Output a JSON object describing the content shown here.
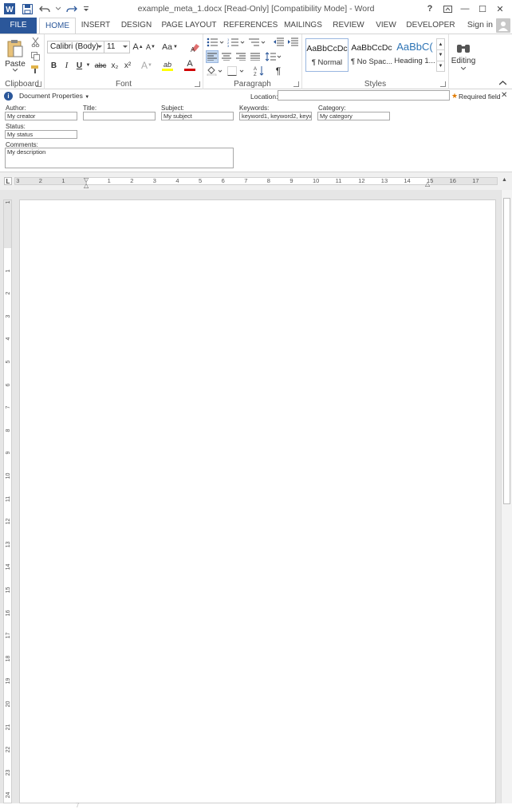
{
  "window": {
    "title": "example_meta_1.docx [Read-Only] [Compatibility Mode] - Word",
    "help": "?",
    "restore": "▭",
    "minimize": "—",
    "maximize": "☐",
    "close": "✕"
  },
  "tabs": [
    {
      "label": "FILE"
    },
    {
      "label": "HOME"
    },
    {
      "label": "INSERT"
    },
    {
      "label": "DESIGN"
    },
    {
      "label": "PAGE LAYOUT"
    },
    {
      "label": "REFERENCES"
    },
    {
      "label": "MAILINGS"
    },
    {
      "label": "REVIEW"
    },
    {
      "label": "VIEW"
    },
    {
      "label": "DEVELOPER"
    }
  ],
  "signin": "Sign in",
  "ribbon": {
    "clipboard": {
      "label": "Clipboard",
      "paste": "Paste"
    },
    "font": {
      "label": "Font",
      "font_name": "Calibri (Body)",
      "font_size": "11",
      "grow": "A",
      "shrink": "A",
      "case": "Aa",
      "bold": "B",
      "italic": "I",
      "underline": "U",
      "strike": "abc",
      "subscript": "x₂",
      "superscript": "x²",
      "effects": "A",
      "highlight": "ab",
      "color": "A"
    },
    "paragraph": {
      "label": "Paragraph",
      "pilcrow": "¶"
    },
    "styles": {
      "label": "Styles",
      "items": [
        {
          "sample": "AaBbCcDc",
          "name": "¶ Normal"
        },
        {
          "sample": "AaBbCcDc",
          "name": "¶ No Spac..."
        },
        {
          "sample": "AaBbC(",
          "name": "Heading 1..."
        }
      ]
    },
    "editing": {
      "label": "Editing"
    }
  },
  "docprops": {
    "header": "Document Properties",
    "location_label": "Location:",
    "location_value": "",
    "required": "Required field",
    "fields": {
      "author": {
        "label": "Author:",
        "value": "My creator"
      },
      "title": {
        "label": "Title:",
        "value": ""
      },
      "subject": {
        "label": "Subject:",
        "value": "My subject"
      },
      "keywords": {
        "label": "Keywords:",
        "value": "keyword1, keyword2, keywor"
      },
      "category": {
        "label": "Category:",
        "value": "My category"
      },
      "status": {
        "label": "Status:",
        "value": "My status"
      },
      "comments": {
        "label": "Comments:",
        "value": "My description"
      }
    }
  },
  "ruler": {
    "h_labels": [
      "3",
      "2",
      "1",
      "1",
      "2",
      "3",
      "4",
      "5",
      "6",
      "7",
      "8",
      "9",
      "10",
      "11",
      "12",
      "13",
      "14",
      "15",
      "16",
      "17"
    ],
    "v_labels": [
      "1",
      "1",
      "2",
      "3",
      "4",
      "5",
      "6",
      "7",
      "8",
      "9",
      "10",
      "11",
      "12",
      "13",
      "14",
      "15",
      "16",
      "17",
      "18",
      "19",
      "20",
      "21",
      "22",
      "23",
      "24"
    ],
    "tab_marker": "L"
  },
  "page_hint": "7",
  "colors": {
    "accent": "#2b579a",
    "ribbon_border": "#d4d4d4",
    "doc_background": "#e6e6e6"
  }
}
